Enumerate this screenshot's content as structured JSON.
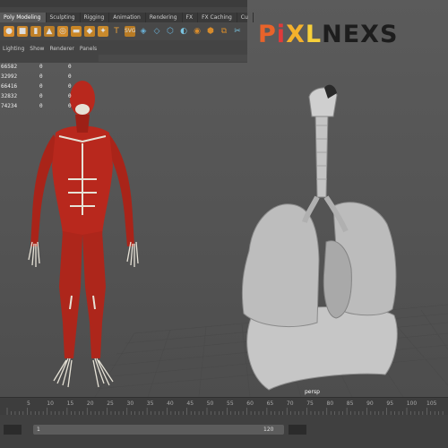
{
  "shelf_tabs": [
    "Poly Modeling",
    "Sculpting",
    "Rigging",
    "Animation",
    "Rendering",
    "FX",
    "FX Caching",
    "Cu"
  ],
  "active_tab": "Poly Modeling",
  "panel_menu": [
    "Lighting",
    "Show",
    "Renderer",
    "Panels"
  ],
  "stats": [
    {
      "value": "66582",
      "a": "0",
      "b": "0"
    },
    {
      "value": "32992",
      "a": "0",
      "b": "0"
    },
    {
      "value": "66416",
      "a": "0",
      "b": "0"
    },
    {
      "value": "32832",
      "a": "0",
      "b": "0"
    },
    {
      "value": "74234",
      "a": "0",
      "b": "0"
    }
  ],
  "logo": {
    "p": "P",
    "i": "i",
    "x": "X",
    "l": "L",
    "rest": "NEXS"
  },
  "camera_label": "persp",
  "timeline_ticks": [
    "5",
    "10",
    "15",
    "20",
    "25",
    "30",
    "35",
    "40",
    "45",
    "50",
    "55",
    "60",
    "65",
    "70",
    "75",
    "80",
    "85",
    "90",
    "95",
    "100",
    "105"
  ],
  "range": {
    "start": "1",
    "end": "120"
  },
  "colors": {
    "muscle": "#b8281d",
    "bone": "#e6e2d6",
    "organ": "#b9b9b9",
    "bg": "#555555"
  }
}
